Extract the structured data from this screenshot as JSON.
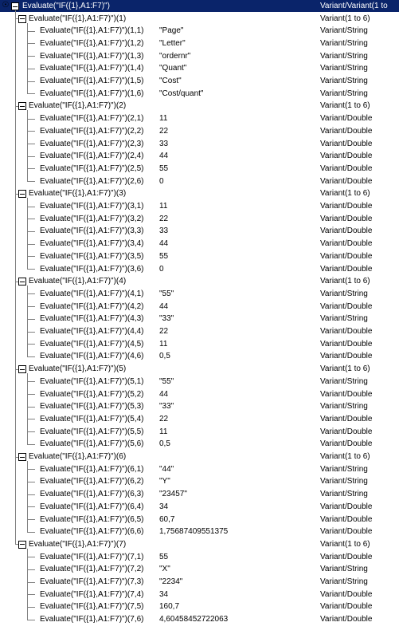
{
  "root": {
    "expression": "Evaluate(\"IF({1},A1:F7)\")",
    "value": "",
    "type": "Variant/Variant(1 to"
  },
  "groups": [
    {
      "expression": "Evaluate(\"IF({1},A1:F7)\")(1)",
      "value": "",
      "type": "Variant(1 to 6)",
      "items": [
        {
          "expression": "Evaluate(\"IF({1},A1:F7)\")(1,1)",
          "value": "\"Page\"",
          "type": "Variant/String"
        },
        {
          "expression": "Evaluate(\"IF({1},A1:F7)\")(1,2)",
          "value": "\"Letter\"",
          "type": "Variant/String"
        },
        {
          "expression": "Evaluate(\"IF({1},A1:F7)\")(1,3)",
          "value": "\"ordernr\"",
          "type": "Variant/String"
        },
        {
          "expression": "Evaluate(\"IF({1},A1:F7)\")(1,4)",
          "value": "\"Quant\"",
          "type": "Variant/String"
        },
        {
          "expression": "Evaluate(\"IF({1},A1:F7)\")(1,5)",
          "value": "\"Cost\"",
          "type": "Variant/String"
        },
        {
          "expression": "Evaluate(\"IF({1},A1:F7)\")(1,6)",
          "value": "\"Cost/quant\"",
          "type": "Variant/String"
        }
      ]
    },
    {
      "expression": "Evaluate(\"IF({1},A1:F7)\")(2)",
      "value": "",
      "type": "Variant(1 to 6)",
      "items": [
        {
          "expression": "Evaluate(\"IF({1},A1:F7)\")(2,1)",
          "value": "11",
          "type": "Variant/Double"
        },
        {
          "expression": "Evaluate(\"IF({1},A1:F7)\")(2,2)",
          "value": "22",
          "type": "Variant/Double"
        },
        {
          "expression": "Evaluate(\"IF({1},A1:F7)\")(2,3)",
          "value": "33",
          "type": "Variant/Double"
        },
        {
          "expression": "Evaluate(\"IF({1},A1:F7)\")(2,4)",
          "value": "44",
          "type": "Variant/Double"
        },
        {
          "expression": "Evaluate(\"IF({1},A1:F7)\")(2,5)",
          "value": "55",
          "type": "Variant/Double"
        },
        {
          "expression": "Evaluate(\"IF({1},A1:F7)\")(2,6)",
          "value": "0",
          "type": "Variant/Double"
        }
      ]
    },
    {
      "expression": "Evaluate(\"IF({1},A1:F7)\")(3)",
      "value": "",
      "type": "Variant(1 to 6)",
      "items": [
        {
          "expression": "Evaluate(\"IF({1},A1:F7)\")(3,1)",
          "value": "11",
          "type": "Variant/Double"
        },
        {
          "expression": "Evaluate(\"IF({1},A1:F7)\")(3,2)",
          "value": "22",
          "type": "Variant/Double"
        },
        {
          "expression": "Evaluate(\"IF({1},A1:F7)\")(3,3)",
          "value": "33",
          "type": "Variant/Double"
        },
        {
          "expression": "Evaluate(\"IF({1},A1:F7)\")(3,4)",
          "value": "44",
          "type": "Variant/Double"
        },
        {
          "expression": "Evaluate(\"IF({1},A1:F7)\")(3,5)",
          "value": "55",
          "type": "Variant/Double"
        },
        {
          "expression": "Evaluate(\"IF({1},A1:F7)\")(3,6)",
          "value": "0",
          "type": "Variant/Double"
        }
      ]
    },
    {
      "expression": "Evaluate(\"IF({1},A1:F7)\")(4)",
      "value": "",
      "type": "Variant(1 to 6)",
      "items": [
        {
          "expression": "Evaluate(\"IF({1},A1:F7)\")(4,1)",
          "value": "\"55\"",
          "type": "Variant/String"
        },
        {
          "expression": "Evaluate(\"IF({1},A1:F7)\")(4,2)",
          "value": "44",
          "type": "Variant/Double"
        },
        {
          "expression": "Evaluate(\"IF({1},A1:F7)\")(4,3)",
          "value": "\"33\"",
          "type": "Variant/String"
        },
        {
          "expression": "Evaluate(\"IF({1},A1:F7)\")(4,4)",
          "value": "22",
          "type": "Variant/Double"
        },
        {
          "expression": "Evaluate(\"IF({1},A1:F7)\")(4,5)",
          "value": "11",
          "type": "Variant/Double"
        },
        {
          "expression": "Evaluate(\"IF({1},A1:F7)\")(4,6)",
          "value": "0,5",
          "type": "Variant/Double"
        }
      ]
    },
    {
      "expression": "Evaluate(\"IF({1},A1:F7)\")(5)",
      "value": "",
      "type": "Variant(1 to 6)",
      "items": [
        {
          "expression": "Evaluate(\"IF({1},A1:F7)\")(5,1)",
          "value": "\"55\"",
          "type": "Variant/String"
        },
        {
          "expression": "Evaluate(\"IF({1},A1:F7)\")(5,2)",
          "value": "44",
          "type": "Variant/Double"
        },
        {
          "expression": "Evaluate(\"IF({1},A1:F7)\")(5,3)",
          "value": "\"33\"",
          "type": "Variant/String"
        },
        {
          "expression": "Evaluate(\"IF({1},A1:F7)\")(5,4)",
          "value": "22",
          "type": "Variant/Double"
        },
        {
          "expression": "Evaluate(\"IF({1},A1:F7)\")(5,5)",
          "value": "11",
          "type": "Variant/Double"
        },
        {
          "expression": "Evaluate(\"IF({1},A1:F7)\")(5,6)",
          "value": "0,5",
          "type": "Variant/Double"
        }
      ]
    },
    {
      "expression": "Evaluate(\"IF({1},A1:F7)\")(6)",
      "value": "",
      "type": "Variant(1 to 6)",
      "items": [
        {
          "expression": "Evaluate(\"IF({1},A1:F7)\")(6,1)",
          "value": "\"44\"",
          "type": "Variant/String"
        },
        {
          "expression": "Evaluate(\"IF({1},A1:F7)\")(6,2)",
          "value": "\"Y\"",
          "type": "Variant/String"
        },
        {
          "expression": "Evaluate(\"IF({1},A1:F7)\")(6,3)",
          "value": "\"23457\"",
          "type": "Variant/String"
        },
        {
          "expression": "Evaluate(\"IF({1},A1:F7)\")(6,4)",
          "value": "34",
          "type": "Variant/Double"
        },
        {
          "expression": "Evaluate(\"IF({1},A1:F7)\")(6,5)",
          "value": "60,7",
          "type": "Variant/Double"
        },
        {
          "expression": "Evaluate(\"IF({1},A1:F7)\")(6,6)",
          "value": "1,75687409551375",
          "type": "Variant/Double"
        }
      ]
    },
    {
      "expression": "Evaluate(\"IF({1},A1:F7)\")(7)",
      "value": "",
      "type": "Variant(1 to 6)",
      "items": [
        {
          "expression": "Evaluate(\"IF({1},A1:F7)\")(7,1)",
          "value": "55",
          "type": "Variant/Double"
        },
        {
          "expression": "Evaluate(\"IF({1},A1:F7)\")(7,2)",
          "value": "\"X\"",
          "type": "Variant/String"
        },
        {
          "expression": "Evaluate(\"IF({1},A1:F7)\")(7,3)",
          "value": "\"2234\"",
          "type": "Variant/String"
        },
        {
          "expression": "Evaluate(\"IF({1},A1:F7)\")(7,4)",
          "value": "34",
          "type": "Variant/Double"
        },
        {
          "expression": "Evaluate(\"IF({1},A1:F7)\")(7,5)",
          "value": "160,7",
          "type": "Variant/Double"
        },
        {
          "expression": "Evaluate(\"IF({1},A1:F7)\")(7,6)",
          "value": "4,60458452722063",
          "type": "Variant/Double"
        }
      ]
    }
  ],
  "colors": {
    "selection": "#0a246a",
    "tree_lines": "#808080",
    "background": "#ffffff"
  },
  "icons": [
    "watch-glasses-icon",
    "collapse-minus-icon"
  ]
}
